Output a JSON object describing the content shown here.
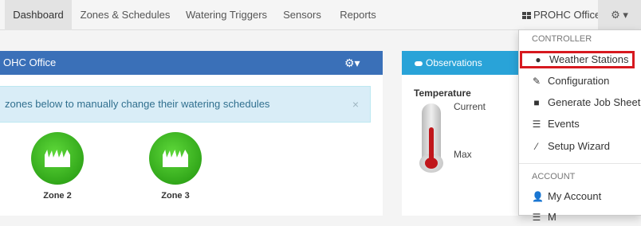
{
  "nav": {
    "tabs": [
      "Dashboard",
      "Zones & Schedules",
      "Watering Triggers",
      "Sensors",
      "Reports"
    ],
    "site": "PROHC Office",
    "gear_caret": "▾"
  },
  "main_panel": {
    "title": "OHC Office",
    "alert": "zones below to manually change their watering schedules",
    "alert_close": "×",
    "zones": [
      "Zone 2",
      "Zone 3"
    ]
  },
  "observations": {
    "title": "Observations",
    "temperature_label": "Temperature",
    "current_label": "Current",
    "max_label": "Max"
  },
  "dropdown": {
    "controller_header": "CONTROLLER",
    "controller_items": [
      {
        "label": "Weather Stations",
        "icon": "globe-icon"
      },
      {
        "label": "Configuration",
        "icon": "edit-icon"
      },
      {
        "label": "Generate Job Sheet",
        "icon": "file-icon"
      },
      {
        "label": "Events",
        "icon": "list-icon"
      },
      {
        "label": "Setup Wizard",
        "icon": "wand-icon"
      }
    ],
    "account_header": "ACCOUNT",
    "account_items": [
      {
        "label": "My Account",
        "icon": "user-icon"
      },
      {
        "label": "M",
        "icon": "list-icon"
      }
    ]
  },
  "colors": {
    "panel_header": "#3a70b8",
    "observations_header": "#29a3d8",
    "alert_bg": "#d9edf7",
    "zone_green": "#3cb521",
    "highlight": "#d7191f"
  }
}
